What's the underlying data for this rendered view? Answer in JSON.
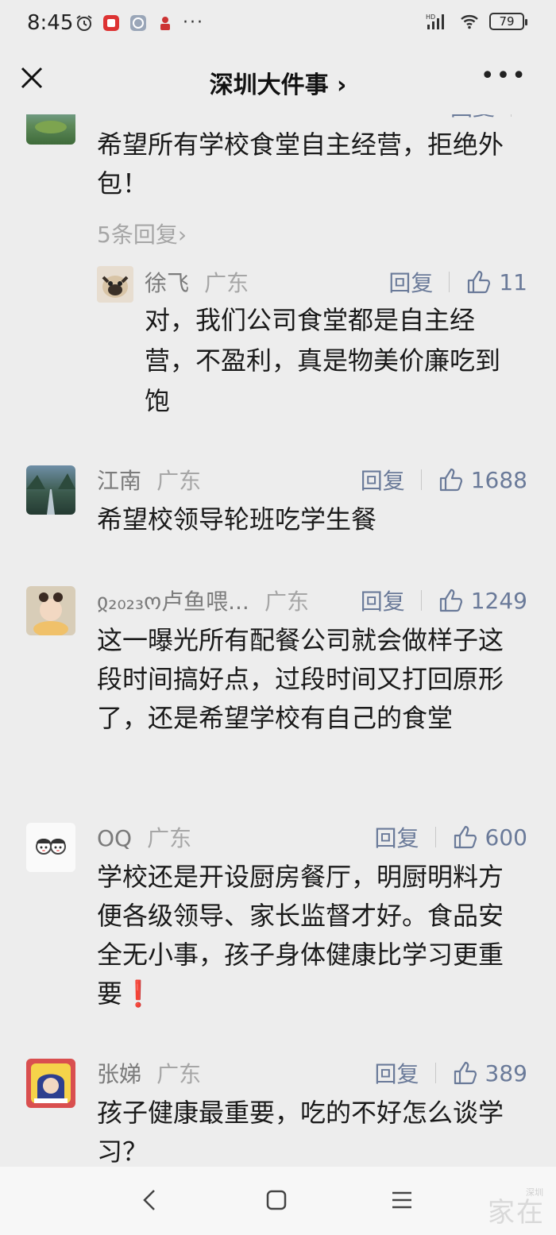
{
  "status_bar": {
    "time": "8:45",
    "battery": "79",
    "network": "HD"
  },
  "nav": {
    "title": "深圳大件事 ›",
    "more": "•••"
  },
  "comments": [
    {
      "name": "",
      "region": "",
      "reply": "回复",
      "likes": "",
      "text": "希望所有学校食堂自主经营，拒绝外包！",
      "more_replies": "5条回复›",
      "sub_reply": {
        "name": "徐飞",
        "region": "广东",
        "reply": "回复",
        "likes": "11",
        "text": "对，我们公司食堂都是自主经营，不盈利，真是物美价廉吃到饱"
      }
    },
    {
      "name": "江南",
      "region": "广东",
      "reply": "回复",
      "likes": "1688",
      "text": "希望校领导轮班吃学生餐"
    },
    {
      "name": "ჲ₂₀₂₃ო卢鱼喂...",
      "region": "广东",
      "reply": "回复",
      "likes": "1249",
      "text": "这一曝光所有配餐公司就会做样子这段时间搞好点，过段时间又打回原形了，还是希望学校有自己的食堂"
    },
    {
      "name": "OQ",
      "region": "广东",
      "reply": "回复",
      "likes": "600",
      "text": "学校还是开设厨房餐厅，明厨明料方便各级领导、家长监督才好。食品安全无小事，孩子身体健康比学习更重要❗"
    },
    {
      "name": "张娣",
      "region": "广东",
      "reply": "回复",
      "likes": "389",
      "text": "孩子健康最重要，吃的不好怎么谈学习？"
    }
  ],
  "watermark": {
    "main": "家在",
    "sub": "深圳"
  },
  "icons": [
    "alarm-icon",
    "app-notify-icon",
    "wechat-icon",
    "cake-icon",
    "signal-icon",
    "wifi-icon",
    "battery-icon",
    "close-icon",
    "more-icon",
    "thumbs-up-icon",
    "back-icon",
    "home-icon",
    "menu-icon"
  ],
  "colors": {
    "background": "#ededed",
    "link": "#6a7a99",
    "muted": "#a6a6a6",
    "alert": "#e02020"
  }
}
